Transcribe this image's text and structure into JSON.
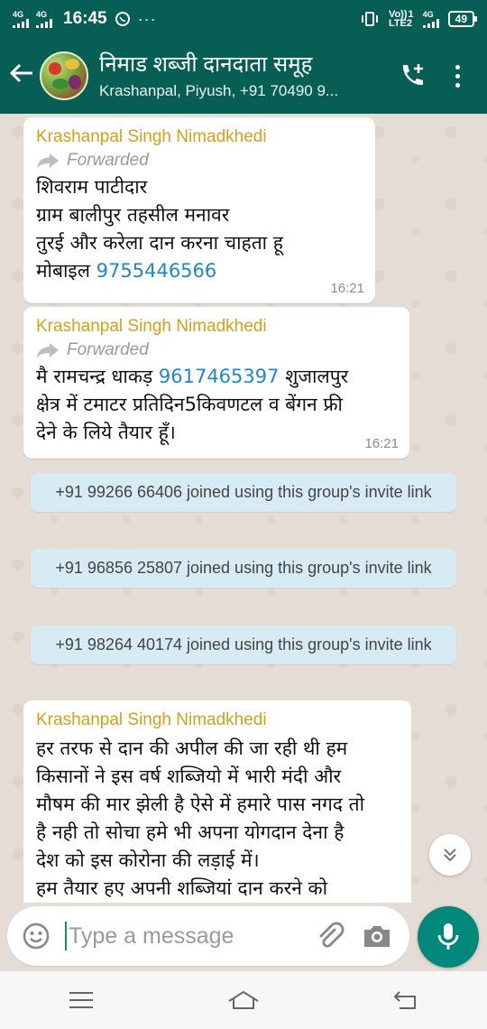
{
  "status_bar": {
    "network_1": "4G",
    "network_2": "4G",
    "time": "16:45",
    "volte": "Vo))",
    "lte": "LTE2",
    "sim_slot": "1",
    "right_network": "4G",
    "battery": "49"
  },
  "header": {
    "title": "निमाड शब्जी दानदाता समूह",
    "subtitle": "Krashanpal, Piyush, +91 70490 9..."
  },
  "messages": [
    {
      "sender": "Krashanpal Singh Nimadkhedi",
      "forwarded": "Forwarded",
      "lines": [
        "शिवराम पाटीदार",
        "ग्राम बालीपुर तहसील मनावर",
        "तुरई और करेला दान करना चाहता हू"
      ],
      "last_prefix": "मोबाइल ",
      "phone": "9755446566",
      "time": "16:21"
    },
    {
      "sender": "Krashanpal Singh Nimadkhedi",
      "forwarded": "Forwarded",
      "line1_prefix": "मै रामचन्द्र धाकड़ ",
      "phone": "9617465397",
      "line1_suffix": " शुजालपुर",
      "line2": "क्षेत्र में टमाटर प्रतिदिन5किवणटल व बेंगन फ्री",
      "line3": "देने के लिये तैयार हूँ।",
      "time": "16:21"
    },
    {
      "sender": "Krashanpal Singh Nimadkhedi",
      "lines": [
        "हर तरफ से दान की अपील की जा रही थी हम",
        "किसानों ने इस वर्ष शब्जियो में भारी मंदी और",
        "मौषम की मार झेली है ऐसे में हमारे पास नगद तो",
        "है नही तो सोचा हमे भी अपना योगदान देना है",
        "देश को इस कोरोना की लड़ाई में।",
        "हम तैयार हए अपनी शब्जियां दान करने को"
      ]
    }
  ],
  "system_messages": [
    "+91 99266 66406 joined using this group's invite link",
    "+91 96856 25807 joined using this group's invite link",
    "+91 98264 40174 joined using this group's invite link"
  ],
  "composer": {
    "placeholder": "Type a message"
  },
  "icons": {
    "back": "arrow-left-icon",
    "call": "add-call-icon",
    "menu": "more-vert-icon",
    "emoji": "emoji-icon",
    "attach": "paperclip-icon",
    "camera": "camera-icon",
    "mic": "mic-icon",
    "scroll": "double-chevron-down-icon"
  },
  "colors": {
    "header": "#075e54",
    "sender": "#d4a017",
    "link": "#1e88c8",
    "system_bubble": "#d6ebf3",
    "mic_button": "#00897b"
  }
}
